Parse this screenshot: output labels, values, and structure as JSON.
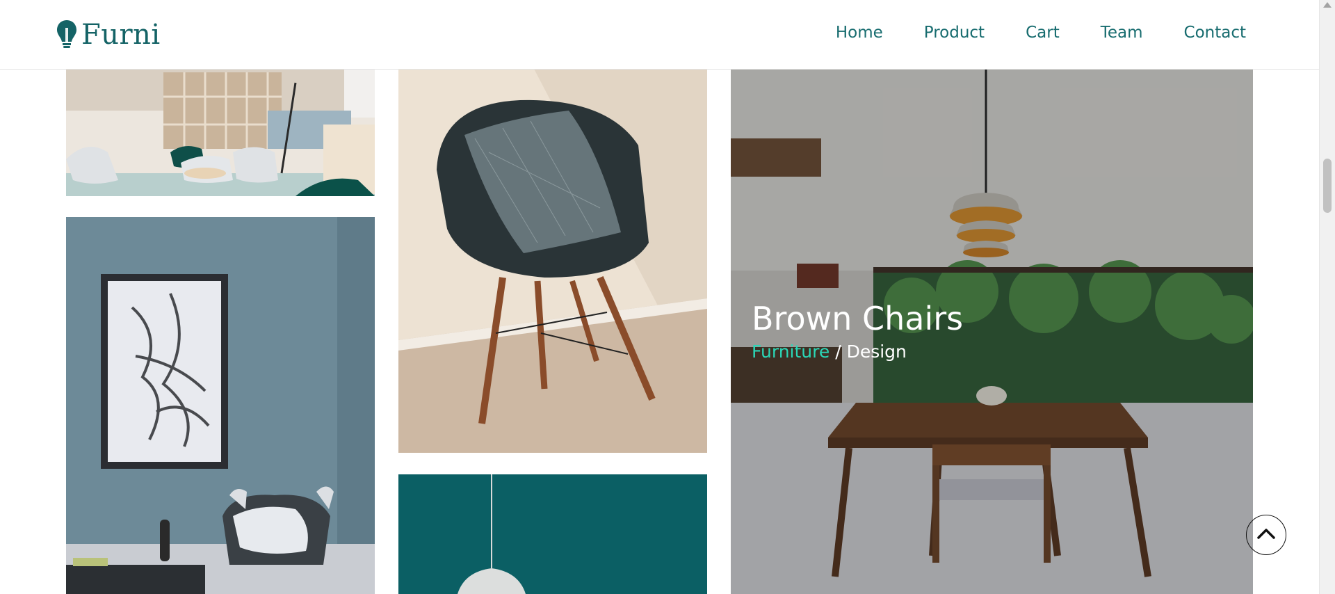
{
  "brand": {
    "name": "Furni",
    "icon": "lightbulb-icon",
    "color": "#146366"
  },
  "nav": {
    "items": [
      {
        "label": "Home"
      },
      {
        "label": "Product"
      },
      {
        "label": "Cart"
      },
      {
        "label": "Team"
      },
      {
        "label": "Contact"
      }
    ]
  },
  "gallery": {
    "tiles": [
      {
        "subject": "lounge with white chairs"
      },
      {
        "subject": "black chair with pillow"
      },
      {
        "subject": "grey armchair with abstract painting"
      },
      {
        "subject": "pendant lamp on teal wall"
      },
      {
        "subject": "dining table with pendant lights"
      }
    ],
    "featured": {
      "title": "Brown Chairs",
      "category": "Furniture",
      "separator": " / ",
      "tag": "Design"
    }
  },
  "back_to_top": {
    "icon": "chevron-up-icon"
  },
  "colors": {
    "accent": "#2bd6b6",
    "nav_text": "#176c6f"
  }
}
